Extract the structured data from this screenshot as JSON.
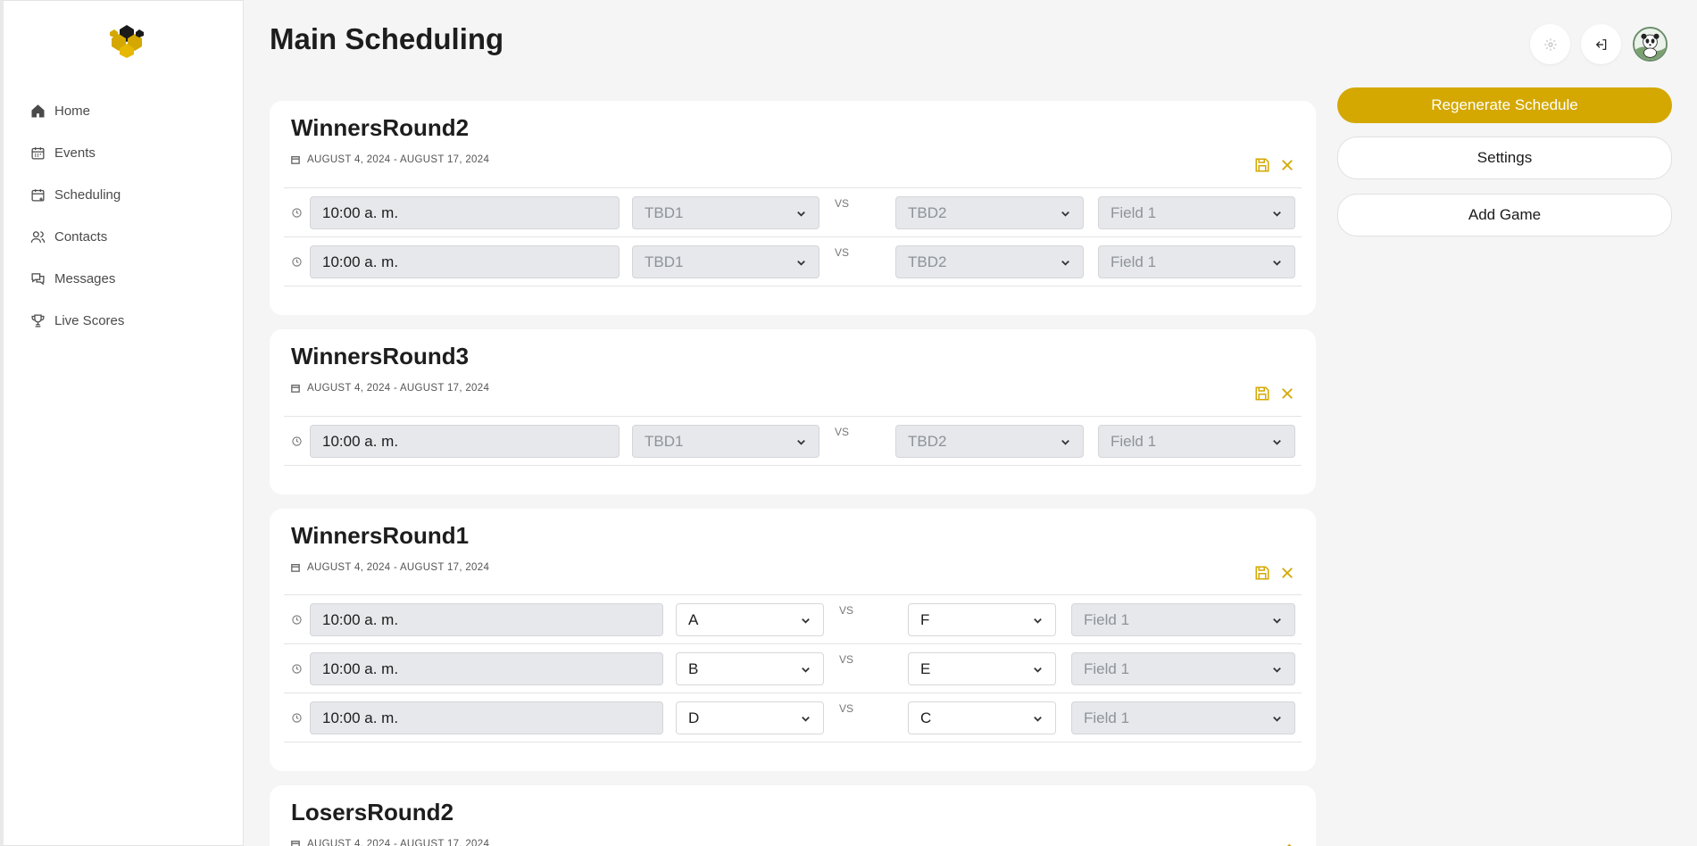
{
  "nav": {
    "items": [
      {
        "label": "Home",
        "icon": "home-icon"
      },
      {
        "label": "Events",
        "icon": "calendar-icon"
      },
      {
        "label": "Scheduling",
        "icon": "calendar-plus-icon"
      },
      {
        "label": "Contacts",
        "icon": "users-icon"
      },
      {
        "label": "Messages",
        "icon": "messages-icon"
      },
      {
        "label": "Live Scores",
        "icon": "trophy-icon"
      }
    ]
  },
  "header": {
    "title": "Main Scheduling"
  },
  "actions": {
    "regenerate": "Regenerate Schedule",
    "settings": "Settings",
    "add_game": "Add Game"
  },
  "colors": {
    "accent": "#d4a800",
    "background": "#f5f5f5"
  },
  "vs_label": "VS",
  "rounds": [
    {
      "name": "WinnersRound2",
      "dates": "AUGUST 4, 2024 - AUGUST 17, 2024",
      "games": [
        {
          "time": "10:00  a. m.",
          "team1": "TBD1",
          "team2": "TBD2",
          "field": "Field 1"
        },
        {
          "time": "10:00  a. m.",
          "team1": "TBD1",
          "team2": "TBD2",
          "field": "Field 1"
        }
      ]
    },
    {
      "name": "WinnersRound3",
      "dates": "AUGUST 4, 2024 - AUGUST 17, 2024",
      "games": [
        {
          "time": "10:00  a. m.",
          "team1": "TBD1",
          "team2": "TBD2",
          "field": "Field 1"
        }
      ]
    },
    {
      "name": "WinnersRound1",
      "dates": "AUGUST 4, 2024 - AUGUST 17, 2024",
      "games": [
        {
          "time": "10:00  a. m.",
          "team1": "A",
          "team2": "F",
          "field": "Field 1"
        },
        {
          "time": "10:00  a. m.",
          "team1": "B",
          "team2": "E",
          "field": "Field 1"
        },
        {
          "time": "10:00  a. m.",
          "team1": "D",
          "team2": "C",
          "field": "Field 1"
        }
      ]
    },
    {
      "name": "LosersRound2",
      "dates": "AUGUST 4, 2024 - AUGUST 17, 2024",
      "games": []
    }
  ]
}
